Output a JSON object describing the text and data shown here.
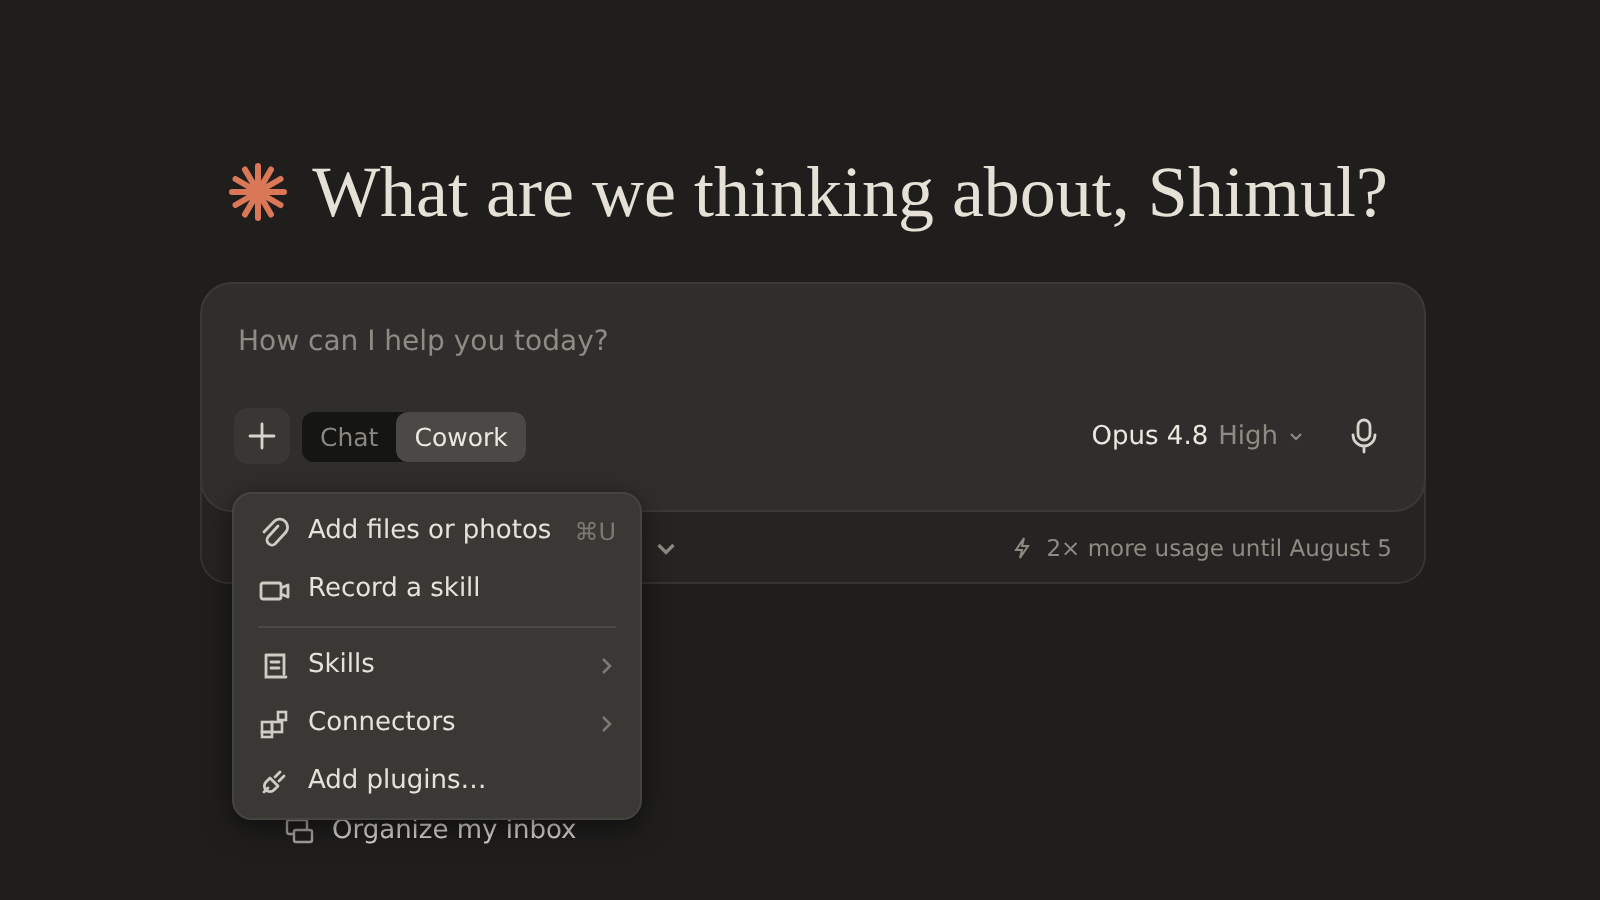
{
  "greeting": {
    "text": "What are we thinking about, Shimul?"
  },
  "composer": {
    "placeholder": "How can I help you today?",
    "model": "Opus 4.8",
    "effort": "High",
    "modes": [
      {
        "label": "Chat",
        "selected": false
      },
      {
        "label": "Cowork",
        "selected": true
      }
    ]
  },
  "footer": {
    "promo": "2× more usage until August 5"
  },
  "menu": {
    "groups": [
      [
        {
          "kind": "action",
          "label": "Add files or photos",
          "shortcut": "⌘U"
        },
        {
          "kind": "action",
          "label": "Record a skill"
        }
      ],
      [
        {
          "kind": "submenu",
          "label": "Skills"
        },
        {
          "kind": "submenu",
          "label": "Connectors"
        },
        {
          "kind": "action",
          "label": "Add plugins…"
        }
      ]
    ]
  },
  "suggestions": [
    {
      "label": "Organize my inbox"
    }
  ]
}
